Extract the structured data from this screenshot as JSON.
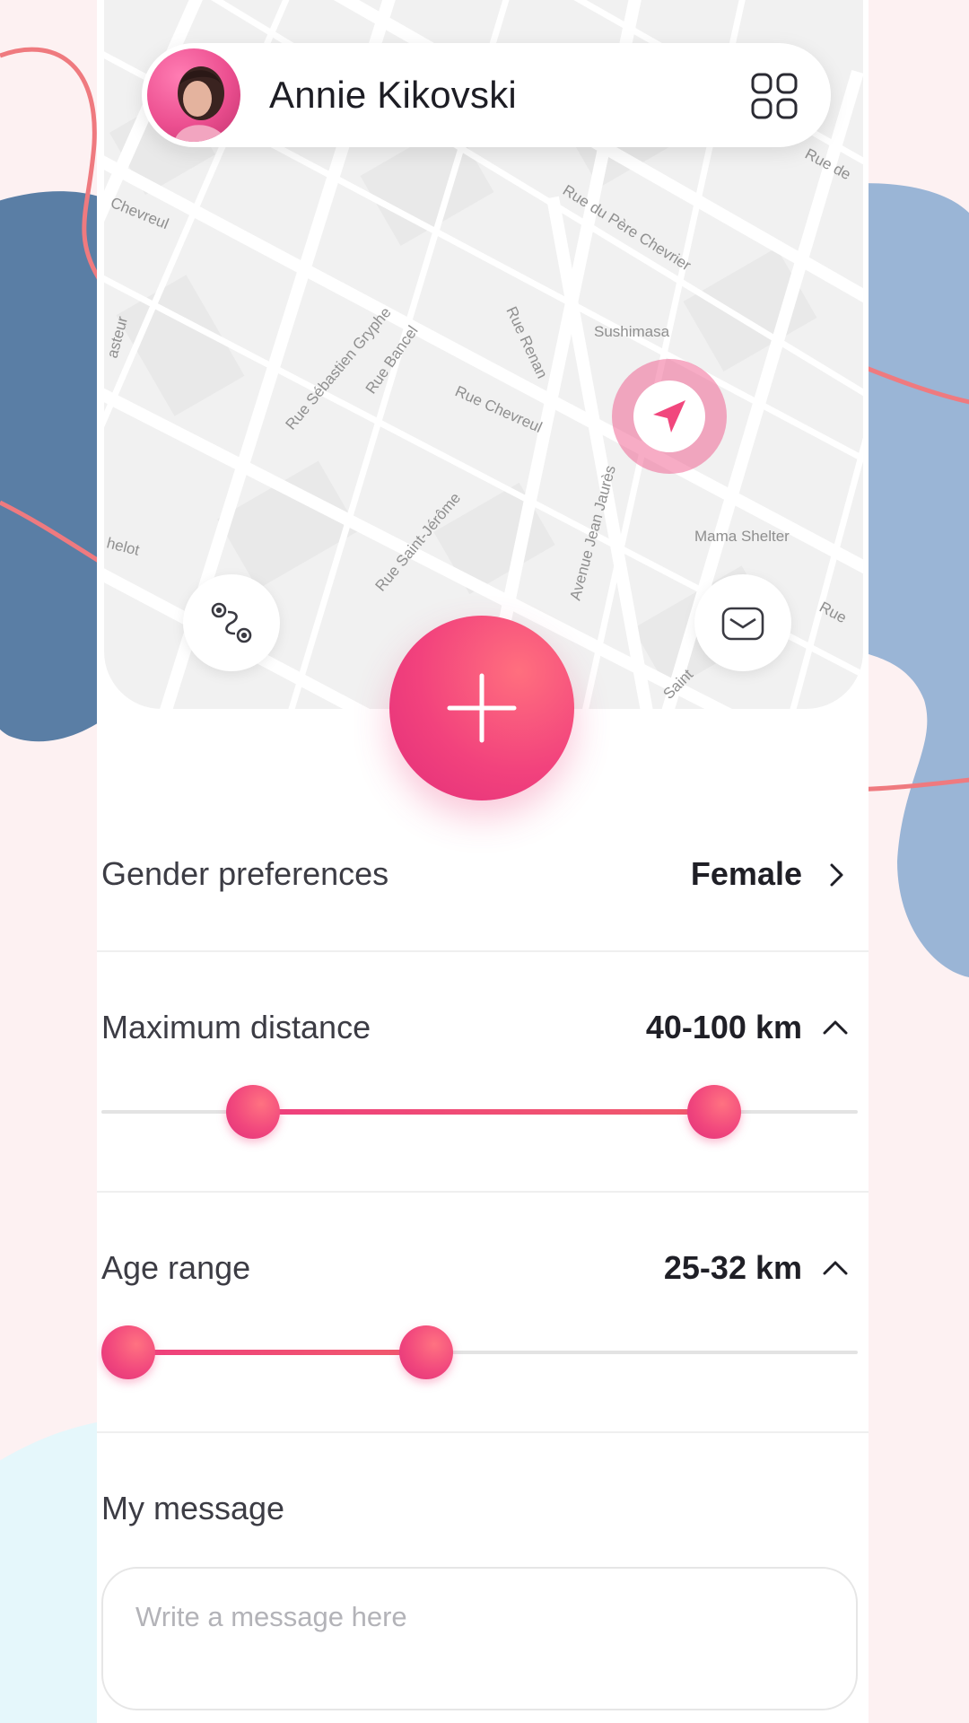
{
  "profile": {
    "name": "Annie Kikovski"
  },
  "map": {
    "street_labels": [
      "Chevreul",
      "Rue du Père Chevrier",
      "Sushimasa",
      "Rue Sébastien Gryphe",
      "Rue Bancel",
      "Rue Renan",
      "Rue Chevreul",
      "Avenue Jean Jaurès",
      "Mama Shelter",
      "Rue Saint-Jérôme",
      "helot",
      "asteur",
      "Rue de",
      "Rue",
      "Saint"
    ]
  },
  "settings": {
    "gender": {
      "label": "Gender preferences",
      "value": "Female"
    },
    "distance": {
      "label": "Maximum distance",
      "value": "40-100 km",
      "range_low": 0.2,
      "range_high": 0.81
    },
    "age": {
      "label": "Age range",
      "value": "25-32 km",
      "range_low": 0.035,
      "range_high": 0.43
    },
    "message": {
      "label": "My message",
      "placeholder": "Write a message here"
    }
  },
  "colors": {
    "accent": "#f1477d",
    "accent_light": "#ff7281",
    "background": "#fdf1f2",
    "blob_dark_blue": "#5a7ea5",
    "blob_light_blue": "#9ab5d6",
    "blob_cyan": "#e5f7fb",
    "squiggle": "#ef7a7f"
  },
  "icons": {
    "grid": "grid-icon",
    "location": "navigation-arrow-icon",
    "route": "route-icon",
    "mail": "mail-icon",
    "add": "plus-icon",
    "chevron_right": "chevron-right-icon",
    "chevron_up": "chevron-up-icon"
  }
}
